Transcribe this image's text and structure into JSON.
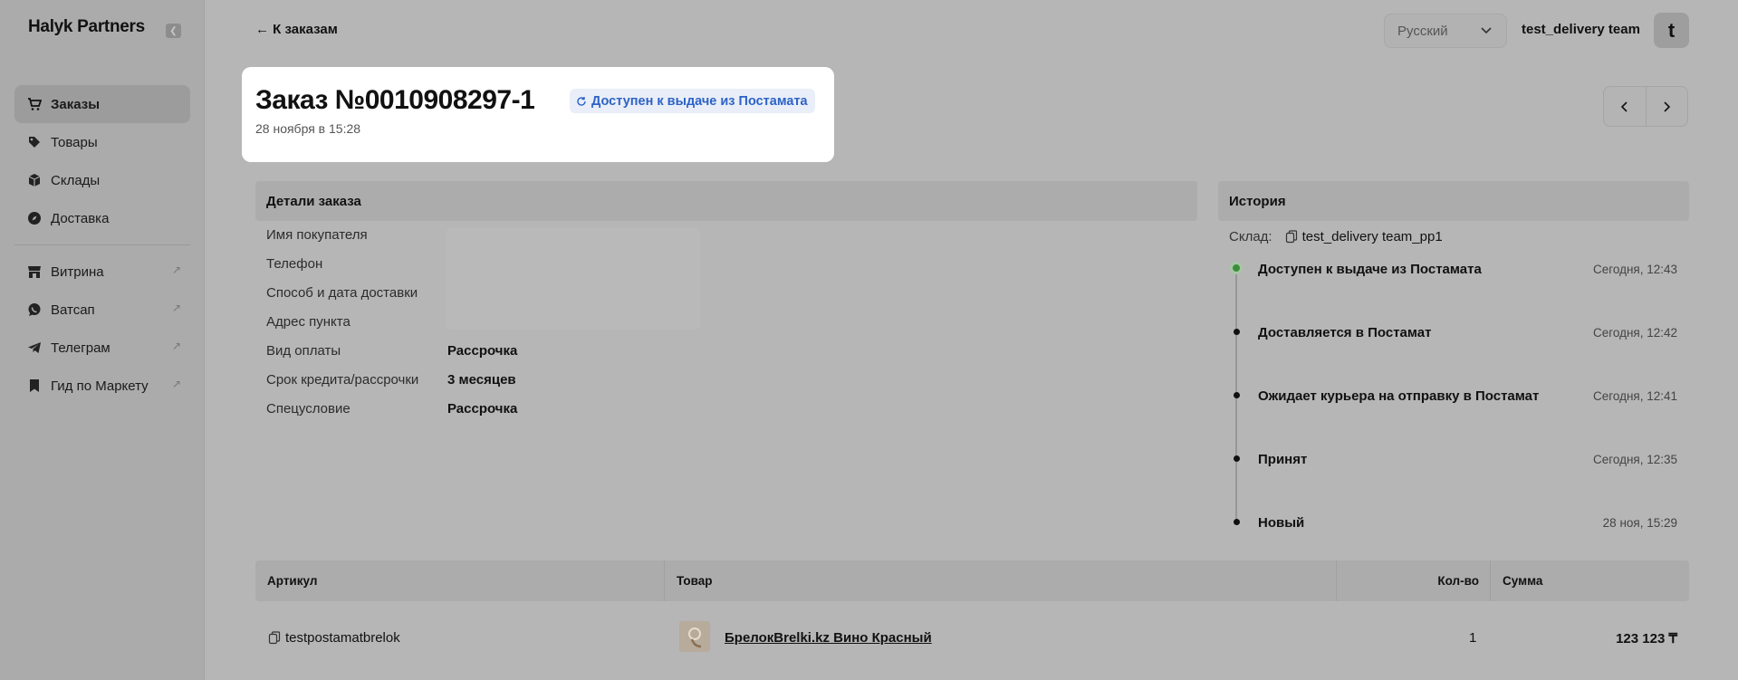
{
  "sidebar": {
    "brand": "Halyk Partners",
    "collapse_icon": "chevron-left-icon",
    "items": [
      {
        "label": "Заказы",
        "icon": "cart-icon",
        "active": true
      },
      {
        "label": "Товары",
        "icon": "tag-icon"
      },
      {
        "label": "Склады",
        "icon": "box-icon"
      },
      {
        "label": "Доставка",
        "icon": "compass-icon"
      },
      {
        "label": "Витрина",
        "icon": "store-icon",
        "external": true
      },
      {
        "label": "Ватсап",
        "icon": "whatsapp-icon",
        "external": true
      },
      {
        "label": "Телеграм",
        "icon": "telegram-icon",
        "external": true
      },
      {
        "label": "Гид по Маркету",
        "icon": "bookmark-icon",
        "external": true
      }
    ]
  },
  "topbar": {
    "back_label": "← К заказам",
    "language": "Русский",
    "user_name": "test_delivery team",
    "avatar_letter": "t"
  },
  "order": {
    "title": "Заказ №0010908297-1",
    "status": "Доступен к выдаче из Постамата",
    "date": "28 ноября в 15:28"
  },
  "details": {
    "heading": "Детали заказа",
    "rows": [
      {
        "label": "Имя покупателя",
        "value": ""
      },
      {
        "label": "Телефон",
        "value": ""
      },
      {
        "label": "Способ и дата доставки",
        "value": ""
      },
      {
        "label": "Адрес пункта",
        "value": ""
      },
      {
        "label": "Вид оплаты",
        "value": "Рассрочка"
      },
      {
        "label": "Срок кредита/рассрочки",
        "value": "3 месяцев"
      },
      {
        "label": "Спецусловие",
        "value": "Рассрочка"
      }
    ]
  },
  "history": {
    "heading": "История",
    "warehouse_label": "Склад:",
    "warehouse_value": "test_delivery team_pp1",
    "events": [
      {
        "status": "Доступен к выдаче из Постамата",
        "time": "Сегодня, 12:43",
        "current": true
      },
      {
        "status": "Доставляется в Постамат",
        "time": "Сегодня, 12:42"
      },
      {
        "status": "Ожидает курьера на отправку в Постамат",
        "time": "Сегодня, 12:41"
      },
      {
        "status": "Принят",
        "time": "Сегодня, 12:35"
      },
      {
        "status": "Новый",
        "time": "28 ноя, 15:29"
      }
    ]
  },
  "items_table": {
    "headers": {
      "sku": "Артикул",
      "product": "Товар",
      "qty": "Кол-во",
      "sum": "Сумма"
    },
    "rows": [
      {
        "sku": "testpostamatbrelok",
        "product": "БрелокBrelki.kz Вино Красный",
        "qty": "1",
        "sum": "123 123 ₸"
      }
    ]
  },
  "colors": {
    "status_text": "#2d63c6",
    "status_bg": "#e9eef8",
    "current_dot": "#3c8e3c"
  }
}
